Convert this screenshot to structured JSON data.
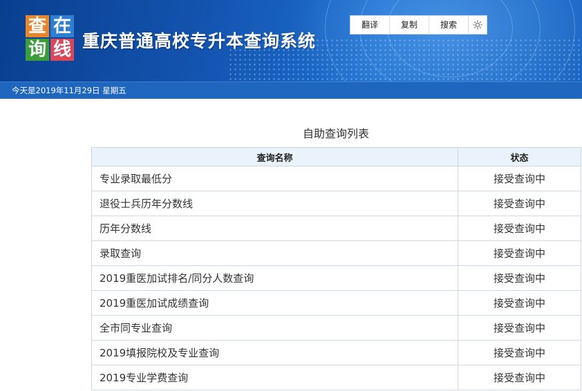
{
  "header": {
    "logo_chars": [
      "查",
      "在",
      "询",
      "线"
    ],
    "logo_colors": [
      "#e8862e",
      "#2f7fd1",
      "#3a9e3a",
      "#d9475a"
    ],
    "site_title": "重庆普通高校专升本查询系统",
    "toolbar": {
      "translate_label": "翻译",
      "copy_label": "复制",
      "search_label": "搜索",
      "settings_icon": "gear-icon"
    }
  },
  "datebar": {
    "text": "今天是2019年11月29日 星期五"
  },
  "main": {
    "title": "自助查询列表",
    "table": {
      "columns": [
        "查询名称",
        "状态"
      ],
      "rows": [
        {
          "name": "专业录取最低分",
          "status": "接受查询中"
        },
        {
          "name": "退役士兵历年分数线",
          "status": "接受查询中"
        },
        {
          "name": "历年分数线",
          "status": "接受查询中"
        },
        {
          "name": "录取查询",
          "status": "接受查询中"
        },
        {
          "name": "2019重医加试排名/同分人数查询",
          "status": "接受查询中"
        },
        {
          "name": "2019重医加试成绩查询",
          "status": "接受查询中"
        },
        {
          "name": "全市同专业查询",
          "status": "接受查询中"
        },
        {
          "name": "2019填报院校及专业查询",
          "status": "接受查询中"
        },
        {
          "name": "2019专业学费查询",
          "status": "接受查询中"
        }
      ]
    }
  },
  "colors": {
    "banner": "#1354b0",
    "datebar": "#1f66bf",
    "table_header": "#eaf2fb"
  }
}
